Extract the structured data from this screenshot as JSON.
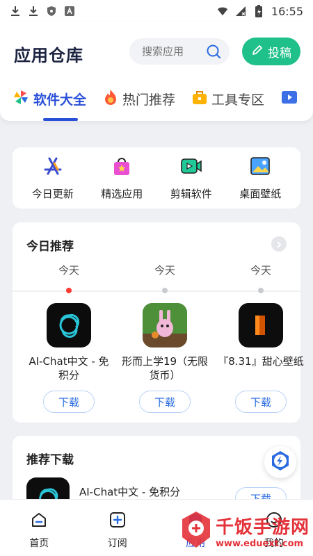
{
  "status_bar": {
    "time": "16:55",
    "left_icons": [
      "download-icon",
      "download-icon",
      "shield-icon",
      "app-a-icon"
    ],
    "right_icons": [
      "wifi-icon",
      "signal-icon",
      "battery-icon"
    ]
  },
  "header": {
    "title": "应用仓库",
    "search_placeholder": "搜索应用",
    "submit_label": "投稿",
    "tabs": [
      {
        "label": "软件大全",
        "icon": "pinwheel-icon",
        "active": true
      },
      {
        "label": "热门推荐",
        "icon": "fire-icon",
        "active": false
      },
      {
        "label": "工具专区",
        "icon": "toolbox-icon",
        "active": false
      },
      {
        "label": "",
        "icon": "video-icon",
        "active": false
      }
    ]
  },
  "categories": [
    {
      "label": "今日更新",
      "icon": "app-store-icon"
    },
    {
      "label": "精选应用",
      "icon": "shopping-bag-icon"
    },
    {
      "label": "剪辑软件",
      "icon": "video-camera-icon"
    },
    {
      "label": "桌面壁纸",
      "icon": "image-icon"
    }
  ],
  "daily": {
    "title": "今日推荐",
    "items": [
      {
        "day": "今天",
        "name": "AI-Chat中文 - 免积分",
        "download": "下载",
        "current": true
      },
      {
        "day": "今天",
        "name": "形而上学19（无限货币）",
        "download": "下载",
        "current": false
      },
      {
        "day": "今天",
        "name": "『8.31』甜心壁纸",
        "download": "下载",
        "current": false
      }
    ]
  },
  "downloads": {
    "title": "推荐下载",
    "items": [
      {
        "name": "AI-Chat中文 - 免积分",
        "download": "下载"
      }
    ]
  },
  "bottom_nav": [
    {
      "label": "首页",
      "icon": "home-icon"
    },
    {
      "label": "订阅",
      "icon": "subscribe-icon"
    },
    {
      "label": "应用",
      "icon": "apps-icon"
    },
    {
      "label": "我的",
      "icon": "profile-icon"
    }
  ],
  "watermark": {
    "brand": "千饭手游网",
    "url": "www.eduext.com"
  },
  "colors": {
    "accent": "#2a4fd8",
    "submit": "#1fc08a",
    "indicator_dot": "#ff3b30"
  }
}
